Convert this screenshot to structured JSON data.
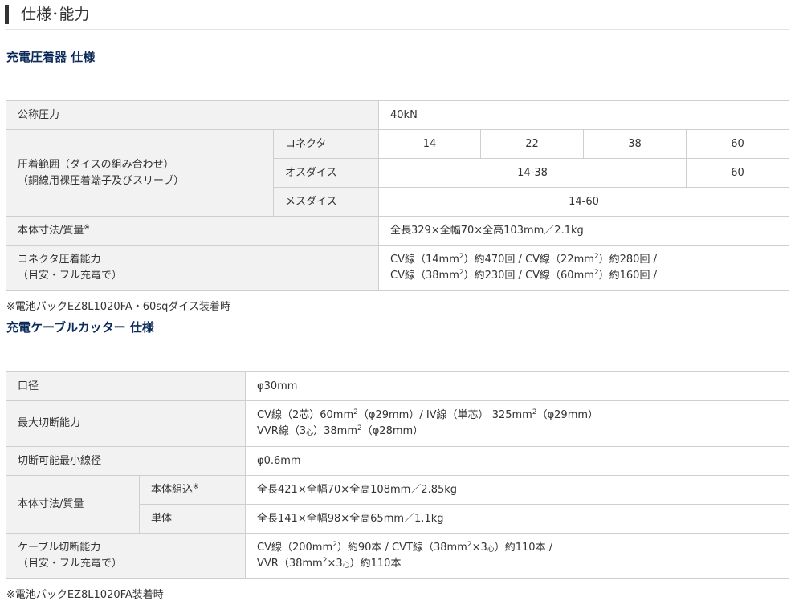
{
  "page_heading": "仕様･能力",
  "crimper": {
    "title": "充電圧着器 仕様",
    "rated_pressure": {
      "label": "公称圧力",
      "value": "40kN"
    },
    "range": {
      "label_line1": "圧着範囲（ダイスの組み合わせ）",
      "label_line2": "（銅線用裸圧着端子及びスリーブ）",
      "connector": {
        "label": "コネクタ",
        "values": [
          "14",
          "22",
          "38",
          "60"
        ]
      },
      "male_die": {
        "label": "オスダイス",
        "values": [
          "14-38",
          "60"
        ]
      },
      "female_die": {
        "label": "メスダイス",
        "value": "14-60"
      }
    },
    "dimensions": {
      "label": "本体寸法/質量",
      "mark": "※",
      "value": "全長329×全幅70×全高103mm／2.1kg"
    },
    "capacity": {
      "label_line1": "コネクタ圧着能力",
      "label_line2": "（目安・フル充電で）",
      "line1": [
        {
          "pre": "CV線（14mm",
          "sup": "2",
          "post": "）約470回 / "
        },
        {
          "pre": "CV線（22mm",
          "sup": "2",
          "post": "）約280回 /"
        }
      ],
      "line2": [
        {
          "pre": "CV線（38mm",
          "sup": "2",
          "post": "）約230回 / "
        },
        {
          "pre": "CV線（60mm",
          "sup": "2",
          "post": "）約160回 /"
        }
      ]
    },
    "note": "※電池パックEZ8L1020FA・60sqダイス装着時"
  },
  "cutter": {
    "title": "充電ケーブルカッター 仕様",
    "bore": {
      "label": "口径",
      "value": "φ30mm"
    },
    "max_cut": {
      "label": "最大切断能力",
      "line1": {
        "a": "CV線（2芯）60mm",
        "sup1": "2",
        "b": "（φ29mm）/ IV線（単芯） 325mm",
        "sup2": "2",
        "c": "（φ29mm）"
      },
      "line2": {
        "a": "VVR線（3",
        "sub": "心",
        "b": "）38mm",
        "sup": "2",
        "c": "（φ28mm）"
      }
    },
    "min_wire": {
      "label": "切断可能最小線径",
      "value": "φ0.6mm"
    },
    "dimensions": {
      "label": "本体寸法/質量",
      "assembled": {
        "label": "本体組込",
        "mark": "※",
        "value": "全長421×全幅70×全高108mm／2.85kg"
      },
      "unit": {
        "label": "単体",
        "value": "全長141×全幅98×全高65mm／1.1kg"
      }
    },
    "capacity": {
      "label_line1": "ケーブル切断能力",
      "label_line2": "（目安・フル充電で）",
      "line1": {
        "a": "CV線（200mm",
        "sup1": "2",
        "b": "）約90本 / CVT線（38mm",
        "sup2": "2",
        "c": "×3",
        "sub": "心",
        "d": "）約110本 /"
      },
      "line2": {
        "a": "VVR（38mm",
        "sup": "2",
        "b": "×3",
        "sub": "心",
        "c": "）約110本"
      }
    },
    "note": "※電池パックEZ8L1020FA装着時"
  }
}
